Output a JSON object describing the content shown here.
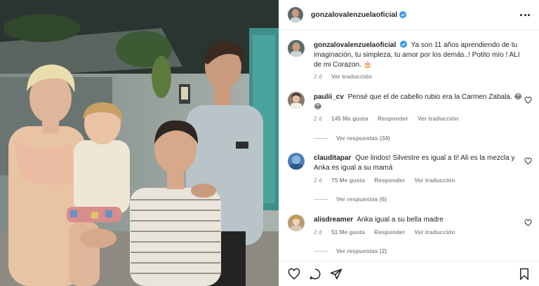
{
  "post": {
    "author": "gonzalovalenzuelaoficial",
    "caption_user": "gonzalovalenzuelaoficial",
    "caption_text": "Ya son 11 años aprendiendo de tu imaginación, tu simpleza, tu amor por los demás..! Potito mío ! ALI de mi Corazon. 🎂",
    "caption_age": "2 d",
    "caption_translate": "Ver traducción"
  },
  "comments": [
    {
      "user": "paulii_cv",
      "text": "Pensé que el de cabello rubio era la Carmen Zabala. 😂😂",
      "age": "2 d",
      "likes": "145 Me gusta",
      "reply": "Responder",
      "translate": "Ver traducción",
      "replies": "Ver respuestas (34)"
    },
    {
      "user": "clauditapar",
      "text": "Que lindos! Silvestre es igual a ti! Ali es la mezcla y Anka es igual a su mamá",
      "age": "2 d",
      "likes": "75 Me gusta",
      "reply": "Responder",
      "translate": "Ver traducción",
      "replies": "Ver respuestas (6)"
    },
    {
      "user": "alisdreamer",
      "text": "Anka igual a su bella madre",
      "age": "2 d",
      "likes": "51 Me gusta",
      "reply": "Responder",
      "translate": "Ver traducción",
      "replies": "Ver respuestas (2)"
    }
  ],
  "icons": {
    "more": "more-options-icon",
    "verified": "verified-badge-icon",
    "like": "heart-icon",
    "comment": "comment-icon",
    "share": "paper-plane-icon",
    "save": "bookmark-icon"
  },
  "colors": {
    "verified": "#3897f0",
    "muted_text": "#8e8e8e",
    "text": "#262626",
    "divider": "#efefef"
  }
}
